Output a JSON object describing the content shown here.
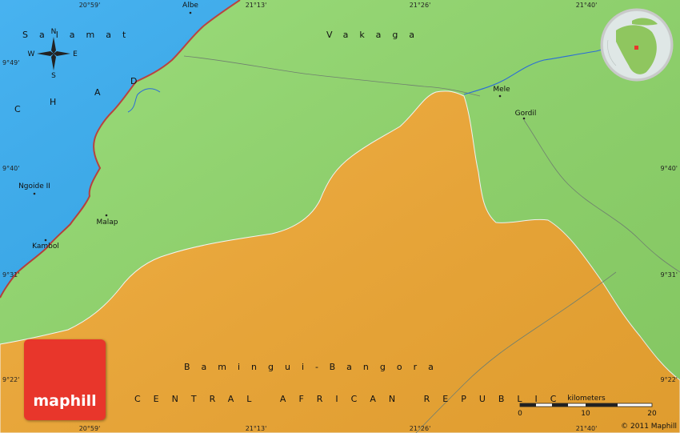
{
  "coords": {
    "top": [
      "20°59'",
      "21°13'",
      "21°26'",
      "21°40'"
    ],
    "bottom": [
      "20°59'",
      "21°13'",
      "21°26'",
      "21°40'"
    ],
    "left": [
      "9°49'",
      "9°40'",
      "9°31'",
      "9°22'"
    ],
    "right": [
      "9°49'",
      "9°40'",
      "9°31'",
      "9°22'"
    ]
  },
  "regions": {
    "salamat": "Salamat",
    "vakaga": "Vakaga",
    "bamingui": "Bamingui-Bangora"
  },
  "countries": {
    "chad": "CHAD",
    "car": "CENTRAL AFRICAN REPUBLIC"
  },
  "places": {
    "albe": "Albe",
    "mele": "Mele",
    "gordil": "Gordil",
    "ngoide": "Ngoide II",
    "malap": "Malap",
    "kambol": "Kambol"
  },
  "compass": {
    "n": "N",
    "e": "E",
    "s": "S",
    "w": "W"
  },
  "scale": {
    "title": "kilometers",
    "ticks": [
      "0",
      "10",
      "20"
    ]
  },
  "copyright": "© 2011 Maphill",
  "logo": "maphill",
  "colors": {
    "chad": "#2fa8ee",
    "car_inner": "#f3aa33",
    "car_outer": "#8fd86a",
    "border": "#b7322e",
    "river": "#2a6cd8",
    "logo": "#e8362b"
  }
}
